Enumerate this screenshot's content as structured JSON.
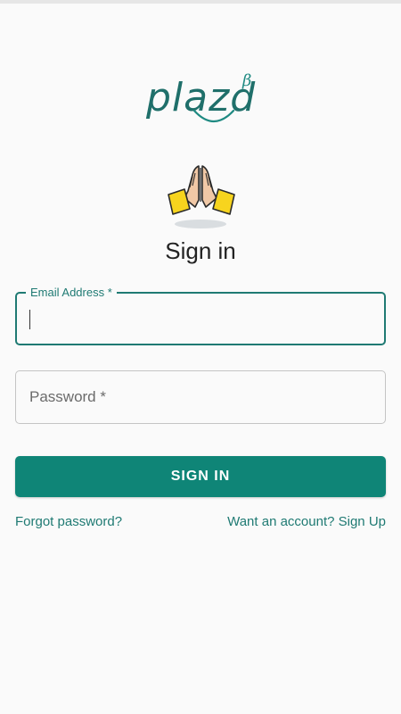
{
  "logo": {
    "text": "plazd",
    "superscript": "β"
  },
  "header": {
    "title": "Sign in"
  },
  "form": {
    "email": {
      "label": "Email Address *",
      "value": ""
    },
    "password": {
      "placeholder": "Password *",
      "value": ""
    },
    "submit_label": "SIGN IN"
  },
  "links": {
    "forgot": "Forgot password?",
    "signup": "Want an account? Sign Up"
  },
  "colors": {
    "accent": "#0f8577",
    "brand_text": "#1f6f6a",
    "background": "#fafafa"
  },
  "icons": {
    "hero": "praying-hands-icon"
  }
}
